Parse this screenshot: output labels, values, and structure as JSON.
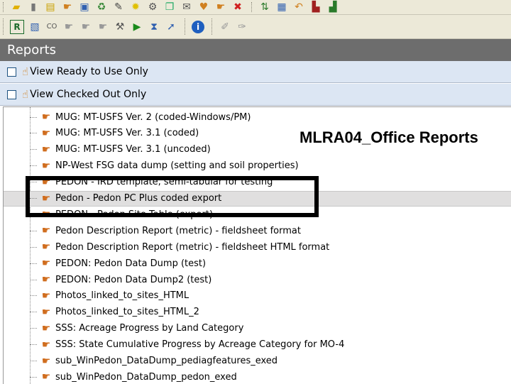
{
  "window": {
    "title": "Reports"
  },
  "toolbar_top": {
    "icons": [
      "folder-icon",
      "trash-icon",
      "open-icon",
      "hand-icon",
      "save-icon",
      "refresh-icon",
      "edit-icon",
      "lightbulb-icon",
      "gear-icon",
      "copy-icon",
      "mail-icon",
      "heart-icon",
      "hand-icon",
      "delete-icon",
      "sort-icon",
      "grid-icon",
      "undo-icon",
      "print-icon",
      "export-icon"
    ]
  },
  "toolbar_second": {
    "icons": [
      "report-icon",
      "add-icon",
      "checkout-icon",
      "hand-icon",
      "hand-icon",
      "hand-icon",
      "tools-icon",
      "play-icon",
      "step-icon",
      "arrow-icon",
      "info-icon",
      "pin-icon",
      "wand-icon"
    ]
  },
  "filters": [
    {
      "label": "View Ready to Use Only",
      "checked": false
    },
    {
      "label": "View Checked Out Only",
      "checked": false
    }
  ],
  "overlay": {
    "title": "MLRA04_Office Reports"
  },
  "reports": [
    {
      "label": "MUG: MT-USFS Ver. 2 (coded-Windows/PM)"
    },
    {
      "label": "MUG: MT-USFS Ver. 3.1 (coded)"
    },
    {
      "label": "MUG: MT-USFS Ver. 3.1 (uncoded)"
    },
    {
      "label": "NP-West FSG data dump (setting and soil properties)"
    },
    {
      "label": "PEDON - IRD template, semi-tabular for testing"
    },
    {
      "label": "Pedon - Pedon PC Plus coded export",
      "selected": true
    },
    {
      "label": "PEDON - Pedon Site Table (export)"
    },
    {
      "label": "Pedon Description Report (metric) - fieldsheet format"
    },
    {
      "label": "Pedon Description Report (metric) - fieldsheet HTML format"
    },
    {
      "label": "PEDON: Pedon Data Dump (test)"
    },
    {
      "label": "PEDON: Pedon Data Dump2 (test)"
    },
    {
      "label": "Photos_linked_to_sites_HTML"
    },
    {
      "label": "Photos_linked_to_sites_HTML_2"
    },
    {
      "label": "SSS: Acreage Progress by Land Category"
    },
    {
      "label": "SSS: State Cumulative Progress by Acreage Category for MO-4"
    },
    {
      "label": "sub_WinPedon_DataDump_pediagfeatures_exed"
    },
    {
      "label": "sub_WinPedon_DataDump_pedon_exed"
    }
  ]
}
